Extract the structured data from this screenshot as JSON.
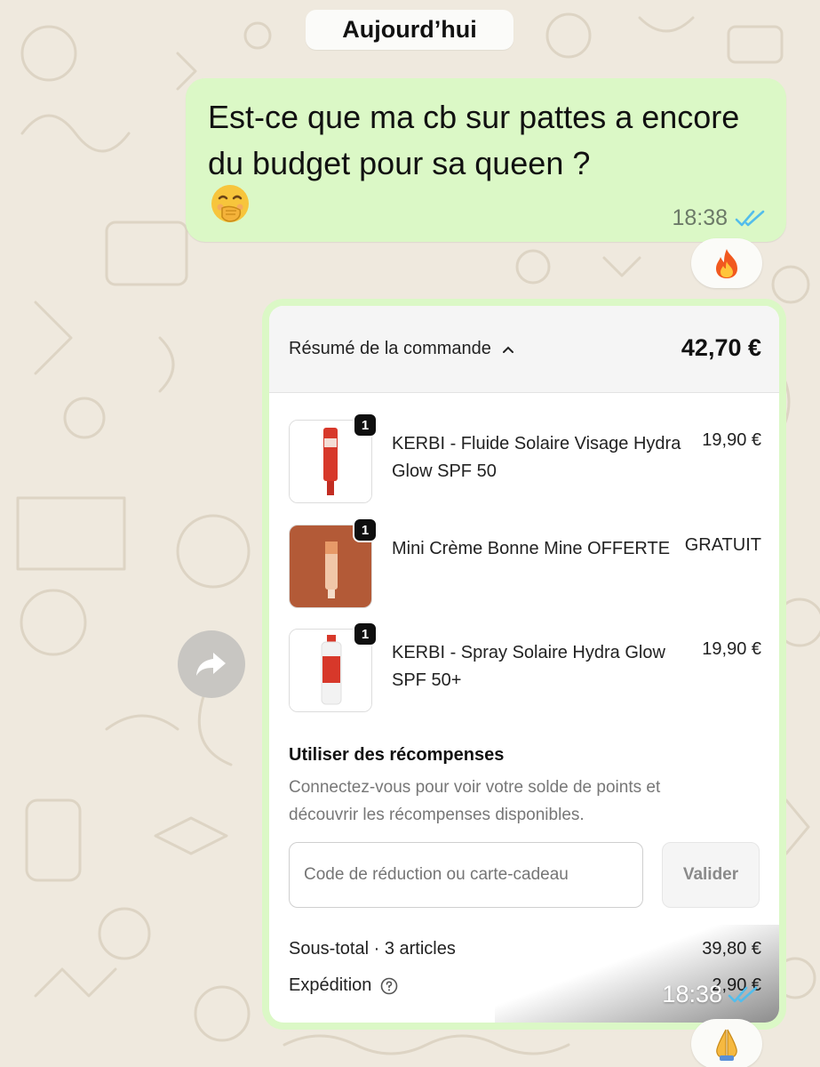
{
  "date_divider": "Aujourd’hui",
  "outgoing_message": {
    "text": "Est-ce que ma cb sur pattes a encore du budget pour sa queen ?",
    "emoji": "hand-over-mouth-emoji",
    "time": "18:38",
    "status": "read"
  },
  "reactions": {
    "first": "fire-emoji",
    "second": "folded-hands-emoji"
  },
  "image_message": {
    "time": "18:38",
    "status": "read",
    "order": {
      "summary_label": "Résumé de la commande",
      "total": "42,70 €",
      "items": [
        {
          "quantity": "1",
          "name": "KERBI - Fluide Solaire Visage Hydra Glow SPF 50",
          "price": "19,90 €"
        },
        {
          "quantity": "1",
          "name": "Mini Crème Bonne Mine OFFERTE",
          "price": "GRATUIT"
        },
        {
          "quantity": "1",
          "name": "KERBI - Spray Solaire Hydra Glow SPF 50+",
          "price": "19,90 €"
        }
      ],
      "rewards_title": "Utiliser des récompenses",
      "rewards_description": "Connectez-vous pour voir votre solde de points et découvrir les récompenses disponibles.",
      "discount_placeholder": "Code de réduction ou carte-cadeau",
      "validate_label": "Valider",
      "subtotal_label": "Sous-total · 3 articles",
      "subtotal_value": "39,80 €",
      "shipping_label": "Expédition",
      "shipping_value": "2,90 €"
    }
  },
  "colors": {
    "background": "#efe9de",
    "outgoing_bubble": "#dbf8c6",
    "read_ticks": "#53bdeb"
  }
}
